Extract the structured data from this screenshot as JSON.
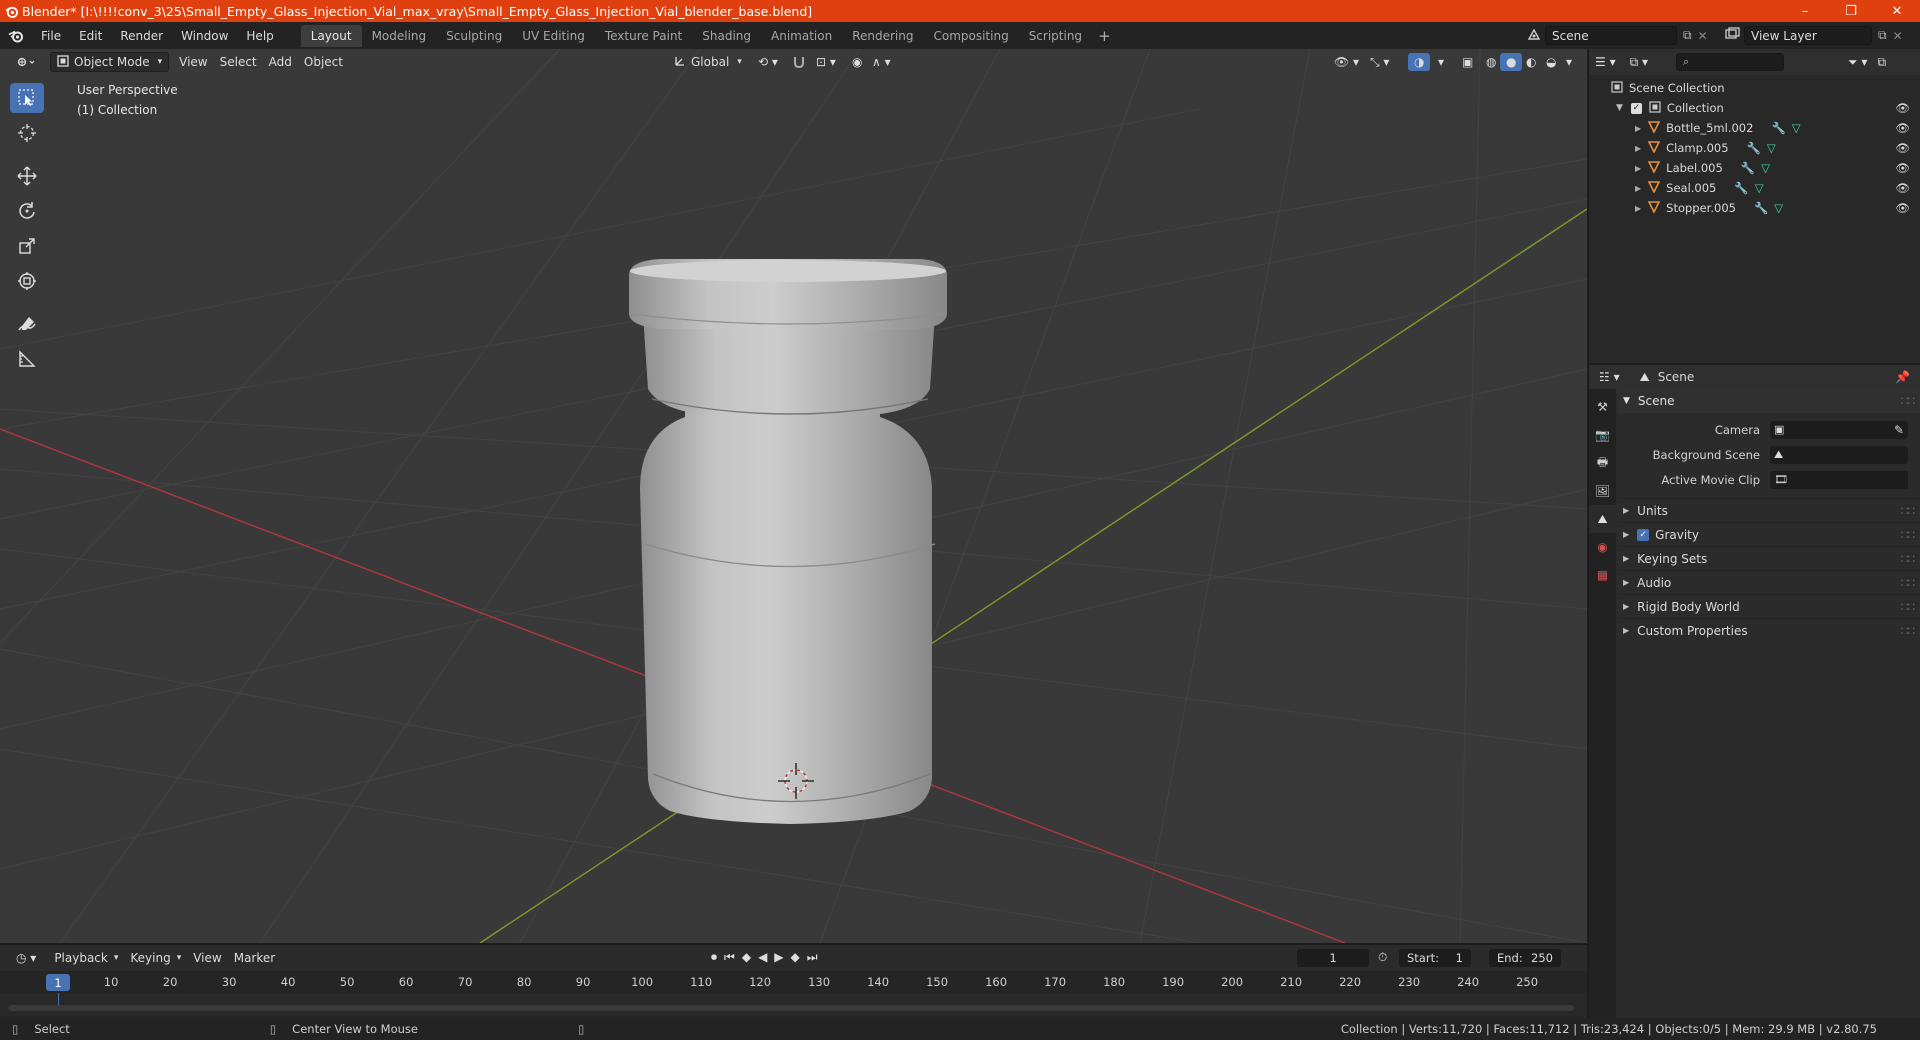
{
  "window": {
    "title": "Blender* [I:\\!!!!conv_3\\25\\Small_Empty_Glass_Injection_Vial_max_vray\\Small_Empty_Glass_Injection_Vial_blender_base.blend]",
    "minimize": "–",
    "restore": "❐",
    "close": "✕"
  },
  "menu": {
    "items": [
      "File",
      "Edit",
      "Render",
      "Window",
      "Help"
    ],
    "workspaces": [
      "Layout",
      "Modeling",
      "Sculpting",
      "UV Editing",
      "Texture Paint",
      "Shading",
      "Animation",
      "Rendering",
      "Compositing",
      "Scripting"
    ],
    "active_workspace": "Layout",
    "add_workspace": "+",
    "scene_label": "Scene",
    "view_layer_label": "View Layer"
  },
  "viewport": {
    "mode": "Object Mode",
    "menus": [
      "View",
      "Select",
      "Add",
      "Object"
    ],
    "transform_orientation": "Global",
    "perspective_label": "User Perspective",
    "collection_label": "(1) Collection",
    "colors": {
      "background": "#393939",
      "x_axis": "#b5353f",
      "y_axis": "#7e9b24"
    }
  },
  "outliner": {
    "root": "Scene Collection",
    "collection": "Collection",
    "objects": [
      "Bottle_5ml.002",
      "Clamp.005",
      "Label.005",
      "Seal.005",
      "Stopper.005"
    ]
  },
  "properties": {
    "context": "Scene",
    "panel_title": "Scene",
    "fields": [
      {
        "label": "Camera",
        "value": ""
      },
      {
        "label": "Background Scene",
        "value": ""
      },
      {
        "label": "Active Movie Clip",
        "value": ""
      }
    ],
    "sub_panels": [
      "Units",
      "Gravity",
      "Keying Sets",
      "Audio",
      "Rigid Body World",
      "Custom Properties"
    ]
  },
  "timeline": {
    "menus": [
      "Playback",
      "Keying",
      "View",
      "Marker"
    ],
    "current_frame": "1",
    "start_label": "Start:",
    "start": "1",
    "end_label": "End:",
    "end": "250",
    "ruler_frame_marker": "1",
    "ticks": [
      "10",
      "20",
      "30",
      "40",
      "50",
      "60",
      "70",
      "80",
      "90",
      "100",
      "110",
      "120",
      "130",
      "140",
      "150",
      "160",
      "170",
      "180",
      "190",
      "200",
      "210",
      "220",
      "230",
      "240",
      "250"
    ]
  },
  "status": {
    "left_action": "Select",
    "middle_action": "Center View to Mouse",
    "stats": "Collection | Verts:11,720 | Faces:11,712 | Tris:23,424 | Objects:0/5 | Mem: 29.9 MB | v2.80.75"
  }
}
